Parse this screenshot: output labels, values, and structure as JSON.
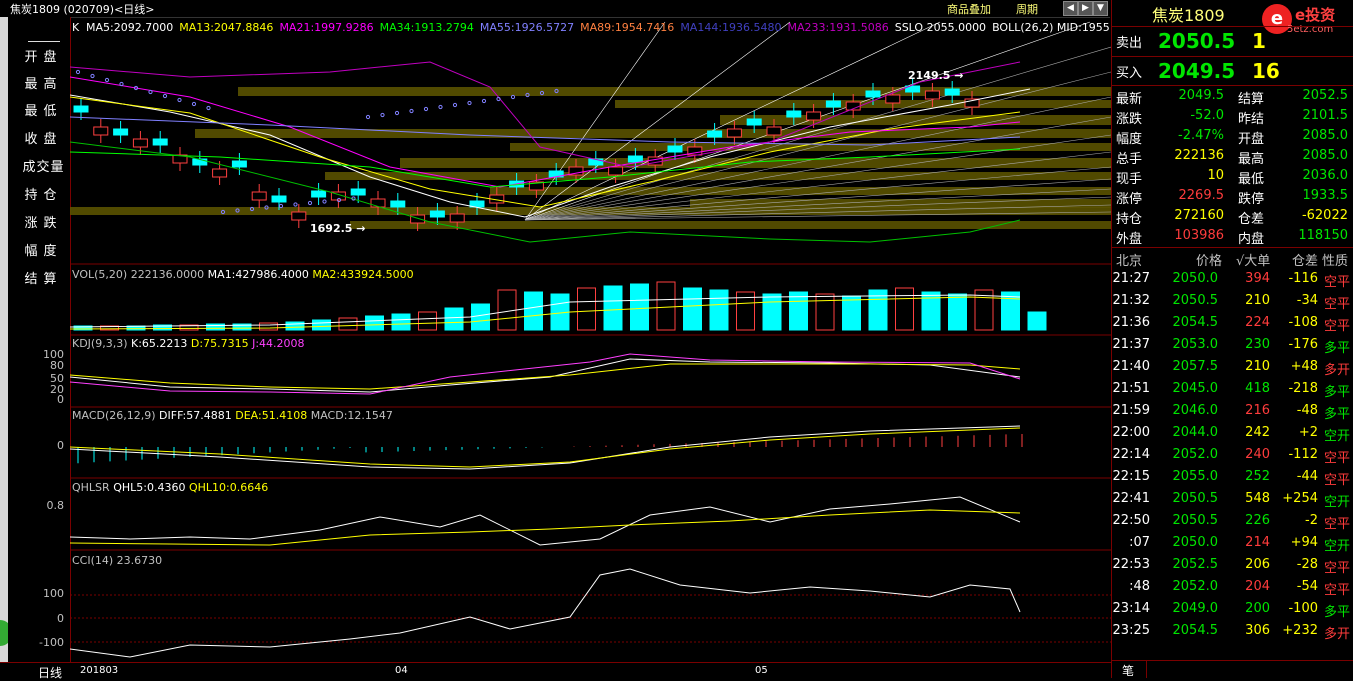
{
  "window": {
    "title": "焦炭1809 (020709)<日线>",
    "toolbar": [
      "商品叠加",
      "周期"
    ]
  },
  "left_menu": [
    "开盘",
    "最高",
    "最低",
    "收盘",
    "成交量",
    "持仓",
    "涨跌",
    "幅度",
    "结算"
  ],
  "main": {
    "ma_header": {
      "k": "K",
      "items": [
        {
          "label": "MA5:2092.7000",
          "color": "#ffffff"
        },
        {
          "label": "MA13:2047.8846",
          "color": "#ffff00"
        },
        {
          "label": "MA21:1997.9286",
          "color": "#ff00ff"
        },
        {
          "label": "MA34:1913.2794",
          "color": "#00ff00"
        },
        {
          "label": "MA55:1926.5727",
          "color": "#8080ff"
        },
        {
          "label": "MA89:1954.7416",
          "color": "#ff8040"
        },
        {
          "label": "MA144:1936.5480",
          "color": "#4040c0"
        },
        {
          "label": "MA233:1931.5086",
          "color": "#c000c0"
        },
        {
          "label": "SSLO 2055.0000",
          "color": "#ffffff"
        },
        {
          "label": "BOLL(26,2) MID:1955",
          "color": "#ffffff"
        }
      ]
    },
    "high_mark": "2149.5",
    "low_mark": "1692.5",
    "vol_header": {
      "a": "VOL(5,20) 222136.0000",
      "b": "MA1:427986.4000",
      "c": "MA2:433924.5000"
    },
    "kdj_header": {
      "a": "KDJ(9,3,3)",
      "b": "K:65.2213",
      "c": "D:75.7315",
      "d": "J:44.2008"
    },
    "kdj_axis": [
      "100",
      "80",
      "50",
      "20",
      "0"
    ],
    "macd_header": {
      "a": "MACD(26,12,9)",
      "b": "DIFF:57.4881",
      "c": "DEA:51.4108",
      "d": "MACD:12.1547"
    },
    "macd_axis": [
      "0"
    ],
    "qhl_header": {
      "a": "QHLSR",
      "b": "QHL5:0.4360",
      "c": "QHL10:0.6646"
    },
    "qhl_axis": [
      "0.8"
    ],
    "cci_header": {
      "a": "CCI(14) 23.6730"
    },
    "cci_axis": [
      "100",
      "0",
      "-100"
    ],
    "x_labels": [
      "201803",
      "04",
      "05"
    ],
    "bottom_label": "日线"
  },
  "quote": {
    "title": "焦炭1809",
    "logo_text": "5etz.com",
    "brand": "e投资",
    "sell": {
      "label": "卖出",
      "price": "2050.5",
      "vol": "1"
    },
    "buy": {
      "label": "买入",
      "price": "2049.5",
      "vol": "16"
    },
    "stats": [
      [
        "最新",
        "2049.5",
        "结算",
        "2052.5"
      ],
      [
        "涨跌",
        "-52.0",
        "昨结",
        "2101.5"
      ],
      [
        "幅度",
        "-2.47%",
        "开盘",
        "2085.0"
      ],
      [
        "总手",
        "222136",
        "最高",
        "2085.0"
      ],
      [
        "现手",
        "10",
        "最低",
        "2036.0"
      ],
      [
        "涨停",
        "2269.5",
        "跌停",
        "1933.5"
      ],
      [
        "持仓",
        "272160",
        "仓差",
        "-62022"
      ],
      [
        "外盘",
        "103986",
        "内盘",
        "118150"
      ]
    ],
    "tick_header": [
      "北京",
      "价格",
      "√大单",
      "仓差",
      "性质"
    ],
    "ticks": [
      [
        "21:27",
        "2050.0",
        "394",
        "-116",
        "空平"
      ],
      [
        "21:32",
        "2050.5",
        "210",
        "-34",
        "空平"
      ],
      [
        "21:36",
        "2054.5",
        "224",
        "-108",
        "空平"
      ],
      [
        "21:37",
        "2053.0",
        "230",
        "-176",
        "多平"
      ],
      [
        "21:40",
        "2057.5",
        "210",
        "+48",
        "多开"
      ],
      [
        "21:51",
        "2045.0",
        "418",
        "-218",
        "多平"
      ],
      [
        "21:59",
        "2046.0",
        "216",
        "-48",
        "多平"
      ],
      [
        "22:00",
        "2044.0",
        "242",
        "+2",
        "空开"
      ],
      [
        "22:14",
        "2052.0",
        "240",
        "-112",
        "空平"
      ],
      [
        "22:15",
        "2055.0",
        "252",
        "-44",
        "空平"
      ],
      [
        "22:41",
        "2050.5",
        "548",
        "+254",
        "空开"
      ],
      [
        "22:50",
        "2050.5",
        "226",
        "-2",
        "空平"
      ],
      [
        ":07",
        "2050.0",
        "214",
        "+94",
        "空开"
      ],
      [
        "22:53",
        "2052.5",
        "206",
        "-28",
        "空平"
      ],
      [
        ":48",
        "2052.0",
        "204",
        "-54",
        "空平"
      ],
      [
        "23:14",
        "2049.0",
        "200",
        "-100",
        "多平"
      ],
      [
        "23:25",
        "2054.5",
        "306",
        "+232",
        "多开"
      ]
    ],
    "bottom_tab": "笔"
  }
}
